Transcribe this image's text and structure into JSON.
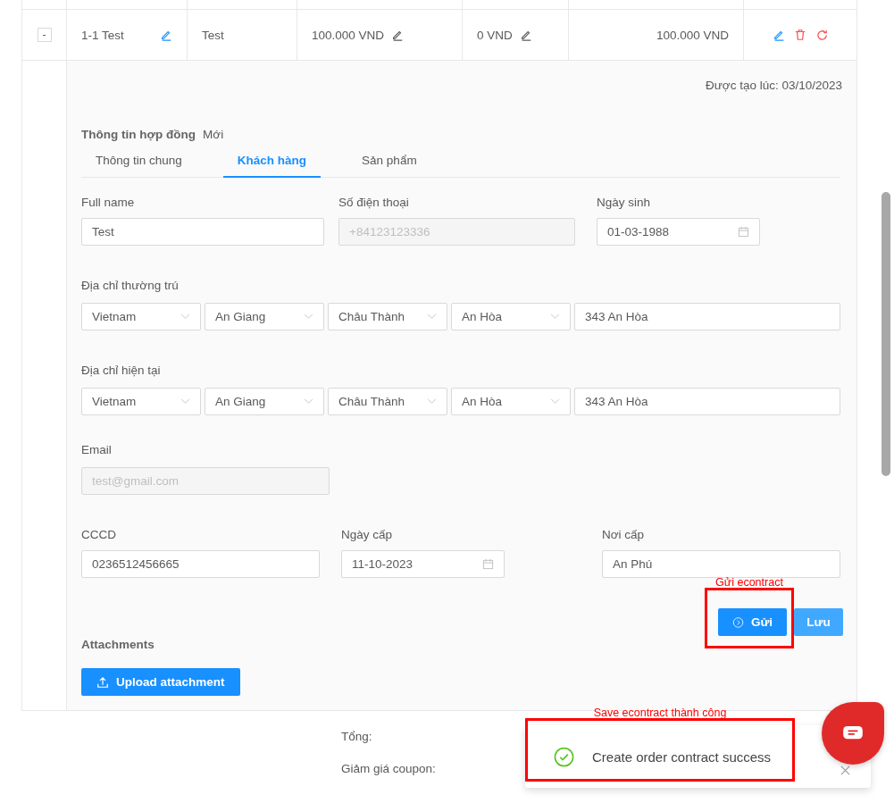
{
  "row": {
    "toggle": "-",
    "name": "1-1 Test",
    "product": "Test",
    "price": "100.000 VND",
    "discount": "0 VND",
    "total": "100.000 VND"
  },
  "created_at": "Được tạo lúc: 03/10/2023",
  "contract": {
    "label": "Thông tin hợp đồng",
    "status": "Mới"
  },
  "tabs": [
    {
      "label": "Thông tin chung",
      "selected": false
    },
    {
      "label": "Khách hàng",
      "selected": true
    },
    {
      "label": "Sản phẩm",
      "selected": false
    }
  ],
  "personal": [
    {
      "label": "Full name",
      "value": "Test",
      "kind": "text",
      "disabled": false
    },
    {
      "label": "Số điện thoại",
      "value": "+84123123336",
      "kind": "text",
      "disabled": true
    },
    {
      "label": "Ngày sinh",
      "value": "01-03-1988",
      "kind": "date",
      "disabled": false
    }
  ],
  "addresses": [
    {
      "label": "Địa chỉ thường trú",
      "selects": [
        "Vietnam",
        "An Giang",
        "Châu Thành",
        "An Hòa"
      ],
      "street": "343 An Hòa"
    },
    {
      "label": "Địa chỉ hiện tại",
      "selects": [
        "Vietnam",
        "An Giang",
        "Châu Thành",
        "An Hòa"
      ],
      "street": "343 An Hòa"
    }
  ],
  "email": {
    "label": "Email",
    "value": "test@gmail.com",
    "disabled": true
  },
  "id_card": [
    {
      "label": "CCCD",
      "value": "0236512456665",
      "kind": "text",
      "disabled": false
    },
    {
      "label": "Ngày cấp",
      "value": "11-10-2023",
      "kind": "date",
      "disabled": false
    },
    {
      "label": "Nơi cấp",
      "value": "An Phú",
      "kind": "text",
      "disabled": false
    }
  ],
  "buttons": [
    {
      "label": "Gửi",
      "kind": "send"
    },
    {
      "label": "Lưu",
      "kind": "save"
    }
  ],
  "attachments": {
    "label": "Attachments",
    "button": "Upload attachment"
  },
  "summary": [
    {
      "label": "Tổng:"
    },
    {
      "label": "Giảm giá coupon:"
    }
  ],
  "toast": {
    "message": "Create order contract success"
  },
  "annotations": [
    {
      "text": "Gửi econtract"
    },
    {
      "text": "Save econtract thành công"
    }
  ]
}
